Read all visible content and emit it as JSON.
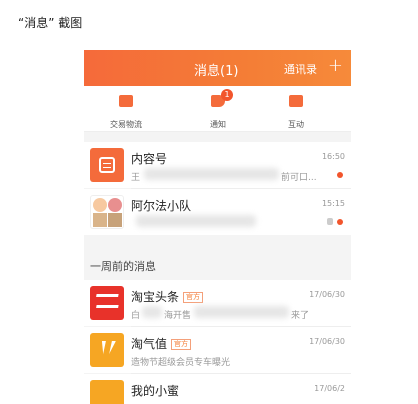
{
  "caption": "“消息” 截图",
  "topbar": {
    "title": "消息(1)",
    "contacts": "通讯录",
    "plus": "+"
  },
  "quick": [
    {
      "label": "交易物流"
    },
    {
      "label": "通知",
      "badge": "1"
    },
    {
      "label": "互动"
    }
  ],
  "conversations": [
    {
      "name": "内容号",
      "snippet": "王",
      "snippet_tail": "前可口...",
      "time": "16:50"
    },
    {
      "name": "阿尔法小队",
      "time": "15:15"
    }
  ],
  "section_title": "一周前的消息",
  "older": [
    {
      "name": "淘宝头条",
      "tag": "官方",
      "snippet": "白",
      "snippet_mid": "海开售",
      "snippet_tail": "来了",
      "time": "17/06/30"
    },
    {
      "name": "淘气值",
      "tag": "官方",
      "snippet": "造物节超级会员专车曝光",
      "time": "17/06/30"
    },
    {
      "name": "我的小蜜",
      "time": "17/06/2"
    }
  ],
  "colors": {
    "accent": "#f47d36",
    "badge": "#f2552c"
  }
}
